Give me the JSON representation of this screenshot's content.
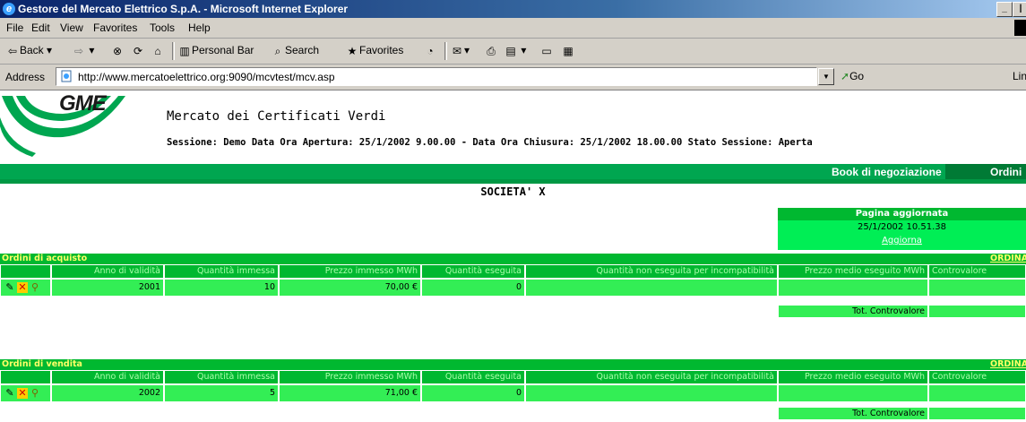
{
  "window": {
    "title": "Gestore del Mercato Elettrico S.p.A. - Microsoft Internet Explorer",
    "minimize_glyph": "_",
    "restore_glyph": "|"
  },
  "menu": [
    "File",
    "Edit",
    "View",
    "Favorites",
    "Tools",
    "Help"
  ],
  "toolbar": {
    "back": "Back",
    "personal_bar": "Personal Bar",
    "search": "Search",
    "favorites": "Favorites"
  },
  "address": {
    "label": "Address",
    "url": "http://www.mercatoelettrico.org:9090/mcvtest/mcv.asp",
    "go": "Go",
    "links": "Links"
  },
  "header": {
    "logo_text": "GME",
    "title": "Mercato dei Certificati Verdi",
    "session": "Sessione: Demo Data Ora Apertura: 25/1/2002 9.00.00 - Data Ora Chiusura: 25/1/2002 18.00.00 Stato Sessione: Aperta"
  },
  "nav": {
    "book": "Book di negoziazione",
    "ordini": "Ordini"
  },
  "company": "SOCIETA' X",
  "update": {
    "heading": "Pagina aggiornata",
    "datetime": "25/1/2002 10.51.38",
    "refresh": "Aggiorna"
  },
  "columns": [
    "Anno di validità",
    "Quantità immessa",
    "Prezzo immesso MWh",
    "Quantità eseguita",
    "Quantità non eseguita per incompatibilità",
    "Prezzo medio eseguito MWh",
    "Controvalore"
  ],
  "buy": {
    "label": "Ordini di acquisto",
    "order_link": "ORDINA",
    "row": [
      "2001",
      "10",
      "70,00 €",
      "0",
      "",
      "",
      ""
    ],
    "total_label": "Tot. Controvalore"
  },
  "sell": {
    "label": "Ordini di vendita",
    "order_link": "ORDINA",
    "row": [
      "2002",
      "5",
      "71,00 €",
      "0",
      "",
      "",
      ""
    ],
    "total_label": "Tot. Controvalore"
  },
  "colors": {
    "nav_green": "#00a650",
    "header_cell": "#00b830",
    "data_cell": "#33ee55"
  }
}
